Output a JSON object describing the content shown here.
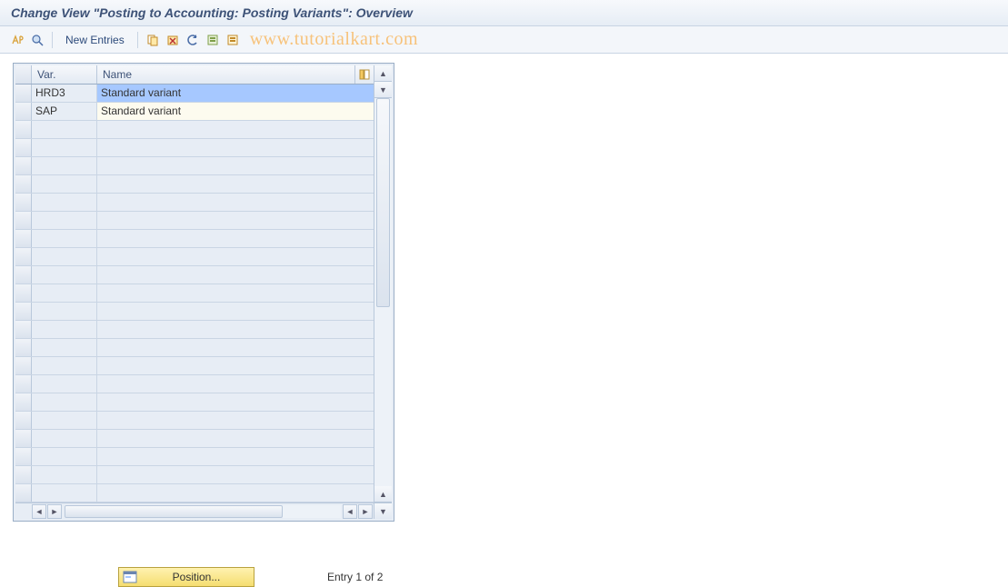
{
  "title": "Change View \"Posting to Accounting: Posting Variants\": Overview",
  "toolbar": {
    "new_entries_label": "New Entries"
  },
  "watermark": "www.tutorialkart.com",
  "grid": {
    "columns": {
      "var": "Var.",
      "name": "Name"
    },
    "rows": [
      {
        "var": "HRD3",
        "name": "Standard variant",
        "highlight": true
      },
      {
        "var": "SAP",
        "name": "Standard variant",
        "highlight": false
      }
    ],
    "empty_row_count": 21
  },
  "footer": {
    "position_label": "Position...",
    "entry_text": "Entry 1 of 2"
  }
}
